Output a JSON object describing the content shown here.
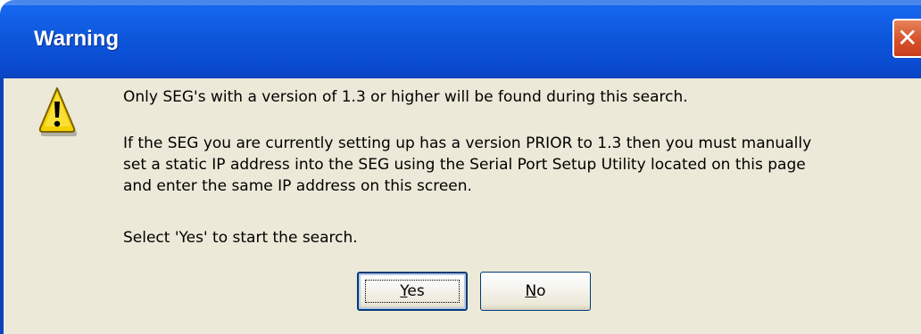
{
  "window": {
    "title": "Warning"
  },
  "icons": {
    "warning": "warning-triangle-icon",
    "close": "close-x-icon",
    "close_glyph": "✕"
  },
  "message": {
    "line1": "Only SEG's with a version of 1.3 or higher will be found during this search.",
    "line2": "If the SEG you are currently setting up has a version PRIOR to 1.3 then you must manually\nset a static IP address into the SEG using the Serial Port Setup Utility located on this page\nand enter the same IP address on this screen.",
    "line3": "Select 'Yes' to start the search."
  },
  "buttons": {
    "yes_label": "Yes",
    "no_label": "No"
  },
  "colors": {
    "titlebar": "#0a54d8",
    "close_button": "#d6502a",
    "client_background": "#ece9d8",
    "warning_yellow": "#f5d000"
  }
}
